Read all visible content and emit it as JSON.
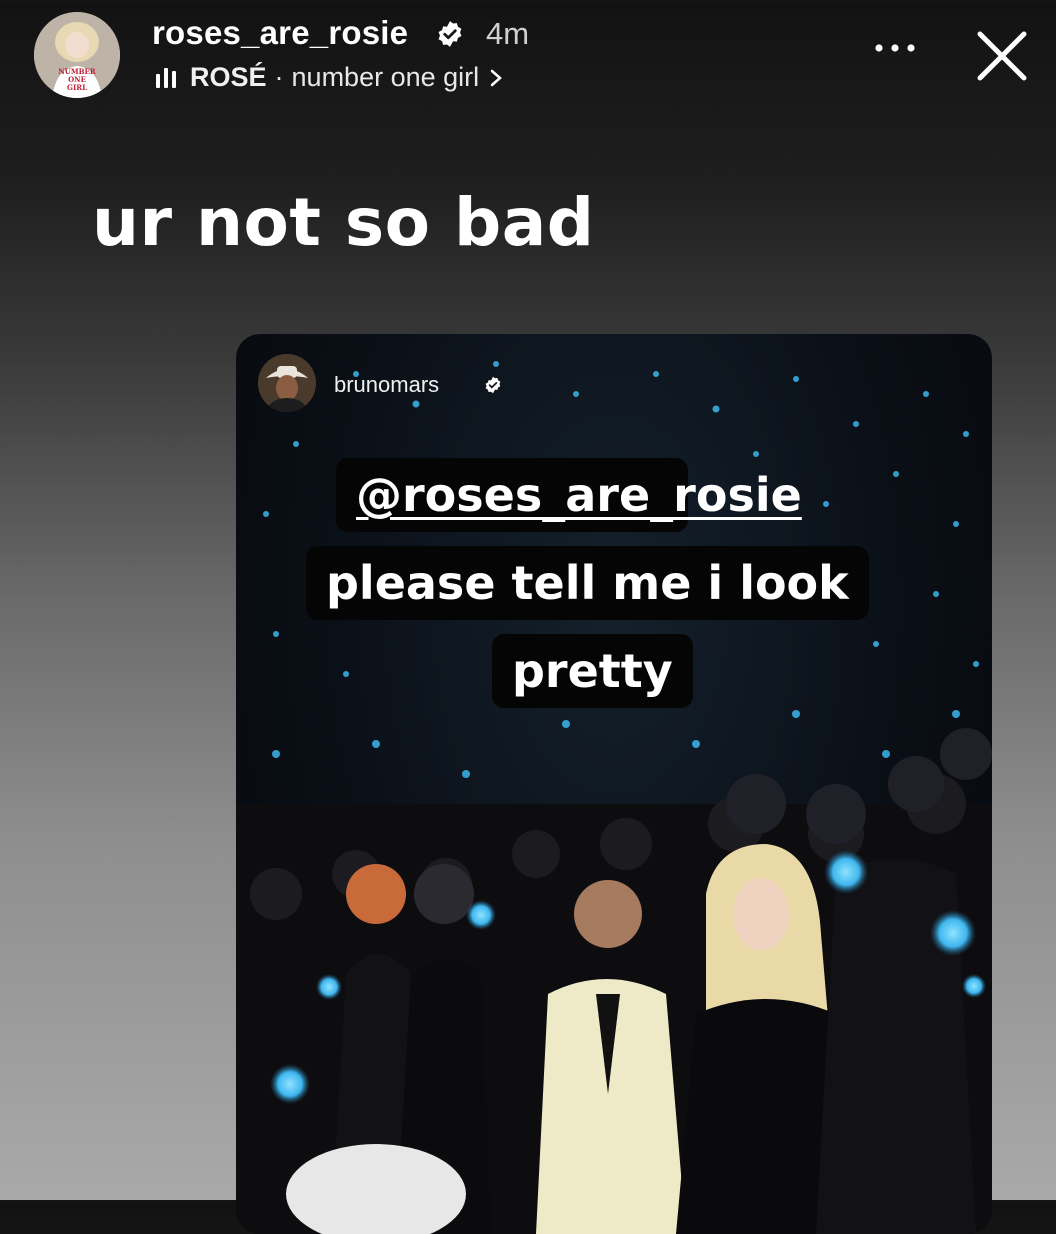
{
  "story": {
    "username": "roses_are_rosie",
    "time_ago": "4m",
    "music": {
      "artist": "ROSÉ",
      "separator": "·",
      "song": "number one girl"
    },
    "avatar_text": [
      "NUMBER",
      "ONE",
      "GIRL"
    ],
    "icons": [
      "verified-badge-icon",
      "music-bars-icon",
      "chevron-right-icon",
      "more-icon",
      "close-icon"
    ],
    "caption": "ur not so bad"
  },
  "embedded_post": {
    "username": "brunomars",
    "sticker_lines": [
      "@roses_are_rosie",
      "please tell me i look",
      "pretty"
    ]
  },
  "colors": {
    "accent_lightstick": "#4fc6ff",
    "text": "#ffffff",
    "label_bg": "#050505"
  }
}
